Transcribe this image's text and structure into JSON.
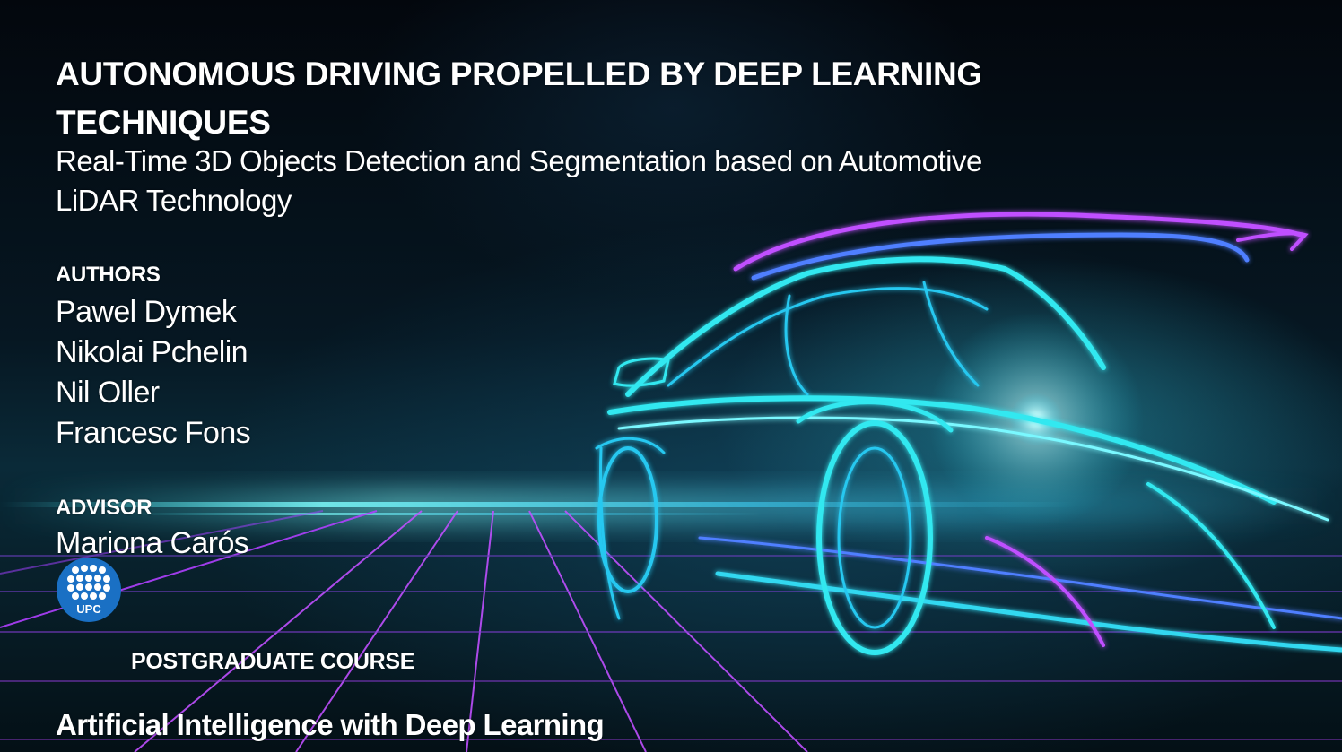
{
  "slide": {
    "title": "AUTONOMOUS DRIVING PROPELLED BY DEEP LEARNING TECHNIQUES",
    "subtitle": "Real-Time 3D Objects Detection and Segmentation based on Automotive LiDAR Technology",
    "authors_heading": "AUTHORS",
    "authors": [
      "Pawel Dymek",
      "Nikolai Pchelin",
      "Nil Oller",
      "Francesc Fons"
    ],
    "advisor_heading": "ADVISOR",
    "advisor": "Mariona Carós",
    "logo": {
      "text": "UPC",
      "icon": "upc-logo-icon",
      "color": "#1a70c4"
    },
    "course_label": "POSTGRADUATE COURSE",
    "course_name": "Artificial Intelligence with Deep Learning"
  },
  "colors": {
    "text": "#ffffff",
    "accent_cyan": "#27e8f0",
    "accent_magenta": "#d94cff",
    "accent_blue": "#3f7cff",
    "background": "#02060c"
  },
  "background_art": {
    "icon": "neon-car-wireframe-icon",
    "grid": "neon-perspective-grid"
  }
}
